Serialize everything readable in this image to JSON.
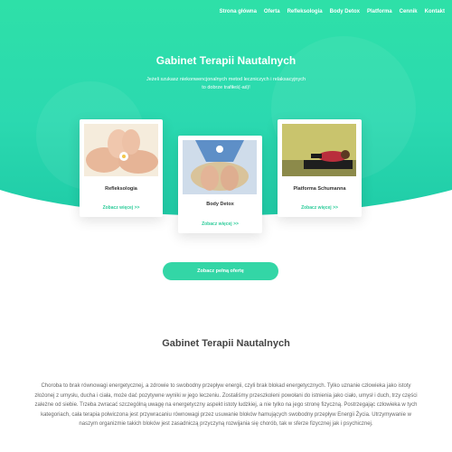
{
  "nav": {
    "items": [
      "Strona główna",
      "Oferta",
      "Refleksologia",
      "Body Detox",
      "Platforma",
      "Cennik",
      "Kontakt"
    ]
  },
  "hero": {
    "title": "Gabinet Terapii Nautalnych",
    "subtitle": "Jeżeli szukasz niekonwencjonalnych metod leczniczych i relaksacyjnych to dobrze trafiłeś(-aś)!"
  },
  "cards": [
    {
      "title": "Refleksologia",
      "link": "Zobacz więcej >>"
    },
    {
      "title": "Body Detox",
      "link": "Zobacz więcej >>"
    },
    {
      "title": "Platforma Schumanna",
      "link": "Zobacz więcej >>"
    }
  ],
  "cta": {
    "label": "Zobacz pełną ofertę"
  },
  "about": {
    "title": "Gabinet Terapii Nautalnych",
    "text": "Choroba to brak równowagi energetycznej, a zdrowie to swobodny przepływ energii, czyli brak blokad energetycznych. Tylko uznanie człowieka jako istoty złożonej z umysłu, ducha i ciała, może dać pozytywne wyniki w jego leczeniu. Zostaliśmy przeszkoleni powołani do istnienia jako ciało, umysł i duch, trzy części zależne od siebie. Trzeba zwracać szczególną uwagę na energetyczny aspekt istoty ludzkiej, a nie tylko na jego stronę fizyczną. Postrzegając człowieka w tych kategoriach, cała terapia polwiczona jest przywracaniu równowagi przez usuwanie bloków hamujących swobodny przepływ Energii Życia. Utrzymywanie w naszym organizmie takich bloków jest zasadniczą przyczyną rozwijania się chorób, tak w sferze fizycznej jak i psychicznej."
  },
  "colors": {
    "accent": "#2ee0a8",
    "button": "#33d6a6",
    "link": "#2ecc9a"
  }
}
